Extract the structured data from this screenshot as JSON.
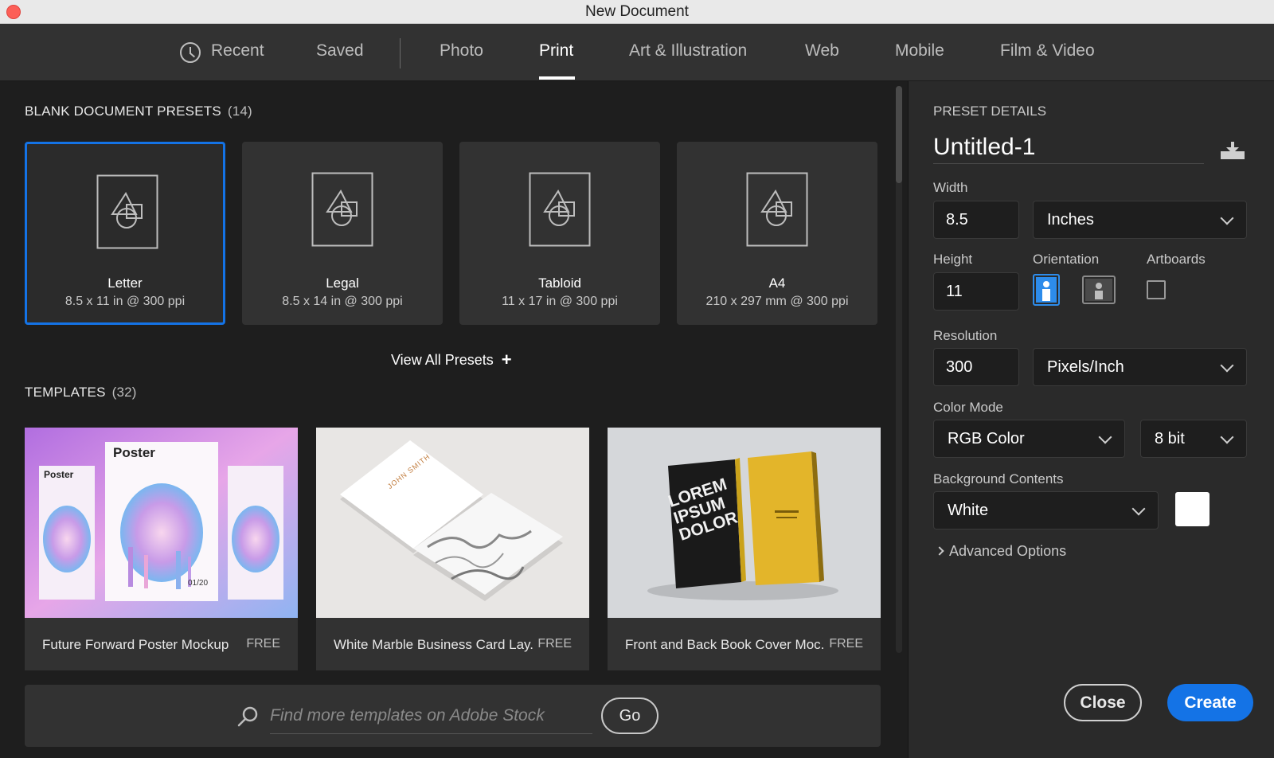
{
  "window": {
    "title": "New Document"
  },
  "tabs": [
    {
      "label": "Recent",
      "icon": "clock-icon"
    },
    {
      "label": "Saved"
    },
    {
      "label": "Photo"
    },
    {
      "label": "Print",
      "active": true
    },
    {
      "label": "Art & Illustration"
    },
    {
      "label": "Web"
    },
    {
      "label": "Mobile"
    },
    {
      "label": "Film & Video"
    }
  ],
  "presets": {
    "title": "BLANK DOCUMENT PRESETS",
    "count": "(14)",
    "items": [
      {
        "name": "Letter",
        "size": "8.5 x 11 in @ 300 ppi",
        "selected": true
      },
      {
        "name": "Legal",
        "size": "8.5 x 14 in @ 300 ppi"
      },
      {
        "name": "Tabloid",
        "size": "11 x 17 in @ 300 ppi"
      },
      {
        "name": "A4",
        "size": "210 x 297 mm @ 300 ppi"
      }
    ],
    "view_all_label": "View All Presets"
  },
  "templates": {
    "title": "TEMPLATES",
    "count": "(32)",
    "items": [
      {
        "name": "Future Forward Poster Mockup",
        "badge": "FREE",
        "thumb_text_1": "Poster",
        "thumb_text_2": "01/20"
      },
      {
        "name": "White Marble Business Card Lay...",
        "badge": "FREE",
        "thumb_text_1": "JOHN SMITH"
      },
      {
        "name": "Front and Back Book Cover Moc...",
        "badge": "FREE",
        "thumb_text_1": "LOREM IPSUM DOLOR"
      }
    ]
  },
  "search": {
    "placeholder": "Find more templates on Adobe Stock",
    "value": "",
    "go_label": "Go"
  },
  "details": {
    "title": "PRESET DETAILS",
    "document_name": "Untitled-1",
    "width_label": "Width",
    "width_value": "8.5",
    "width_unit": "Inches",
    "height_label": "Height",
    "height_value": "11",
    "orientation_label": "Orientation",
    "artboards_label": "Artboards",
    "resolution_label": "Resolution",
    "resolution_value": "300",
    "resolution_unit": "Pixels/Inch",
    "color_mode_label": "Color Mode",
    "color_mode": "RGB Color",
    "bit_depth": "8 bit",
    "background_label": "Background Contents",
    "background": "White",
    "advanced_label": "Advanced Options",
    "close_label": "Close",
    "create_label": "Create"
  },
  "colors": {
    "accent": "#1473e6",
    "panel": "#323232",
    "background": "#1e1e1e"
  }
}
